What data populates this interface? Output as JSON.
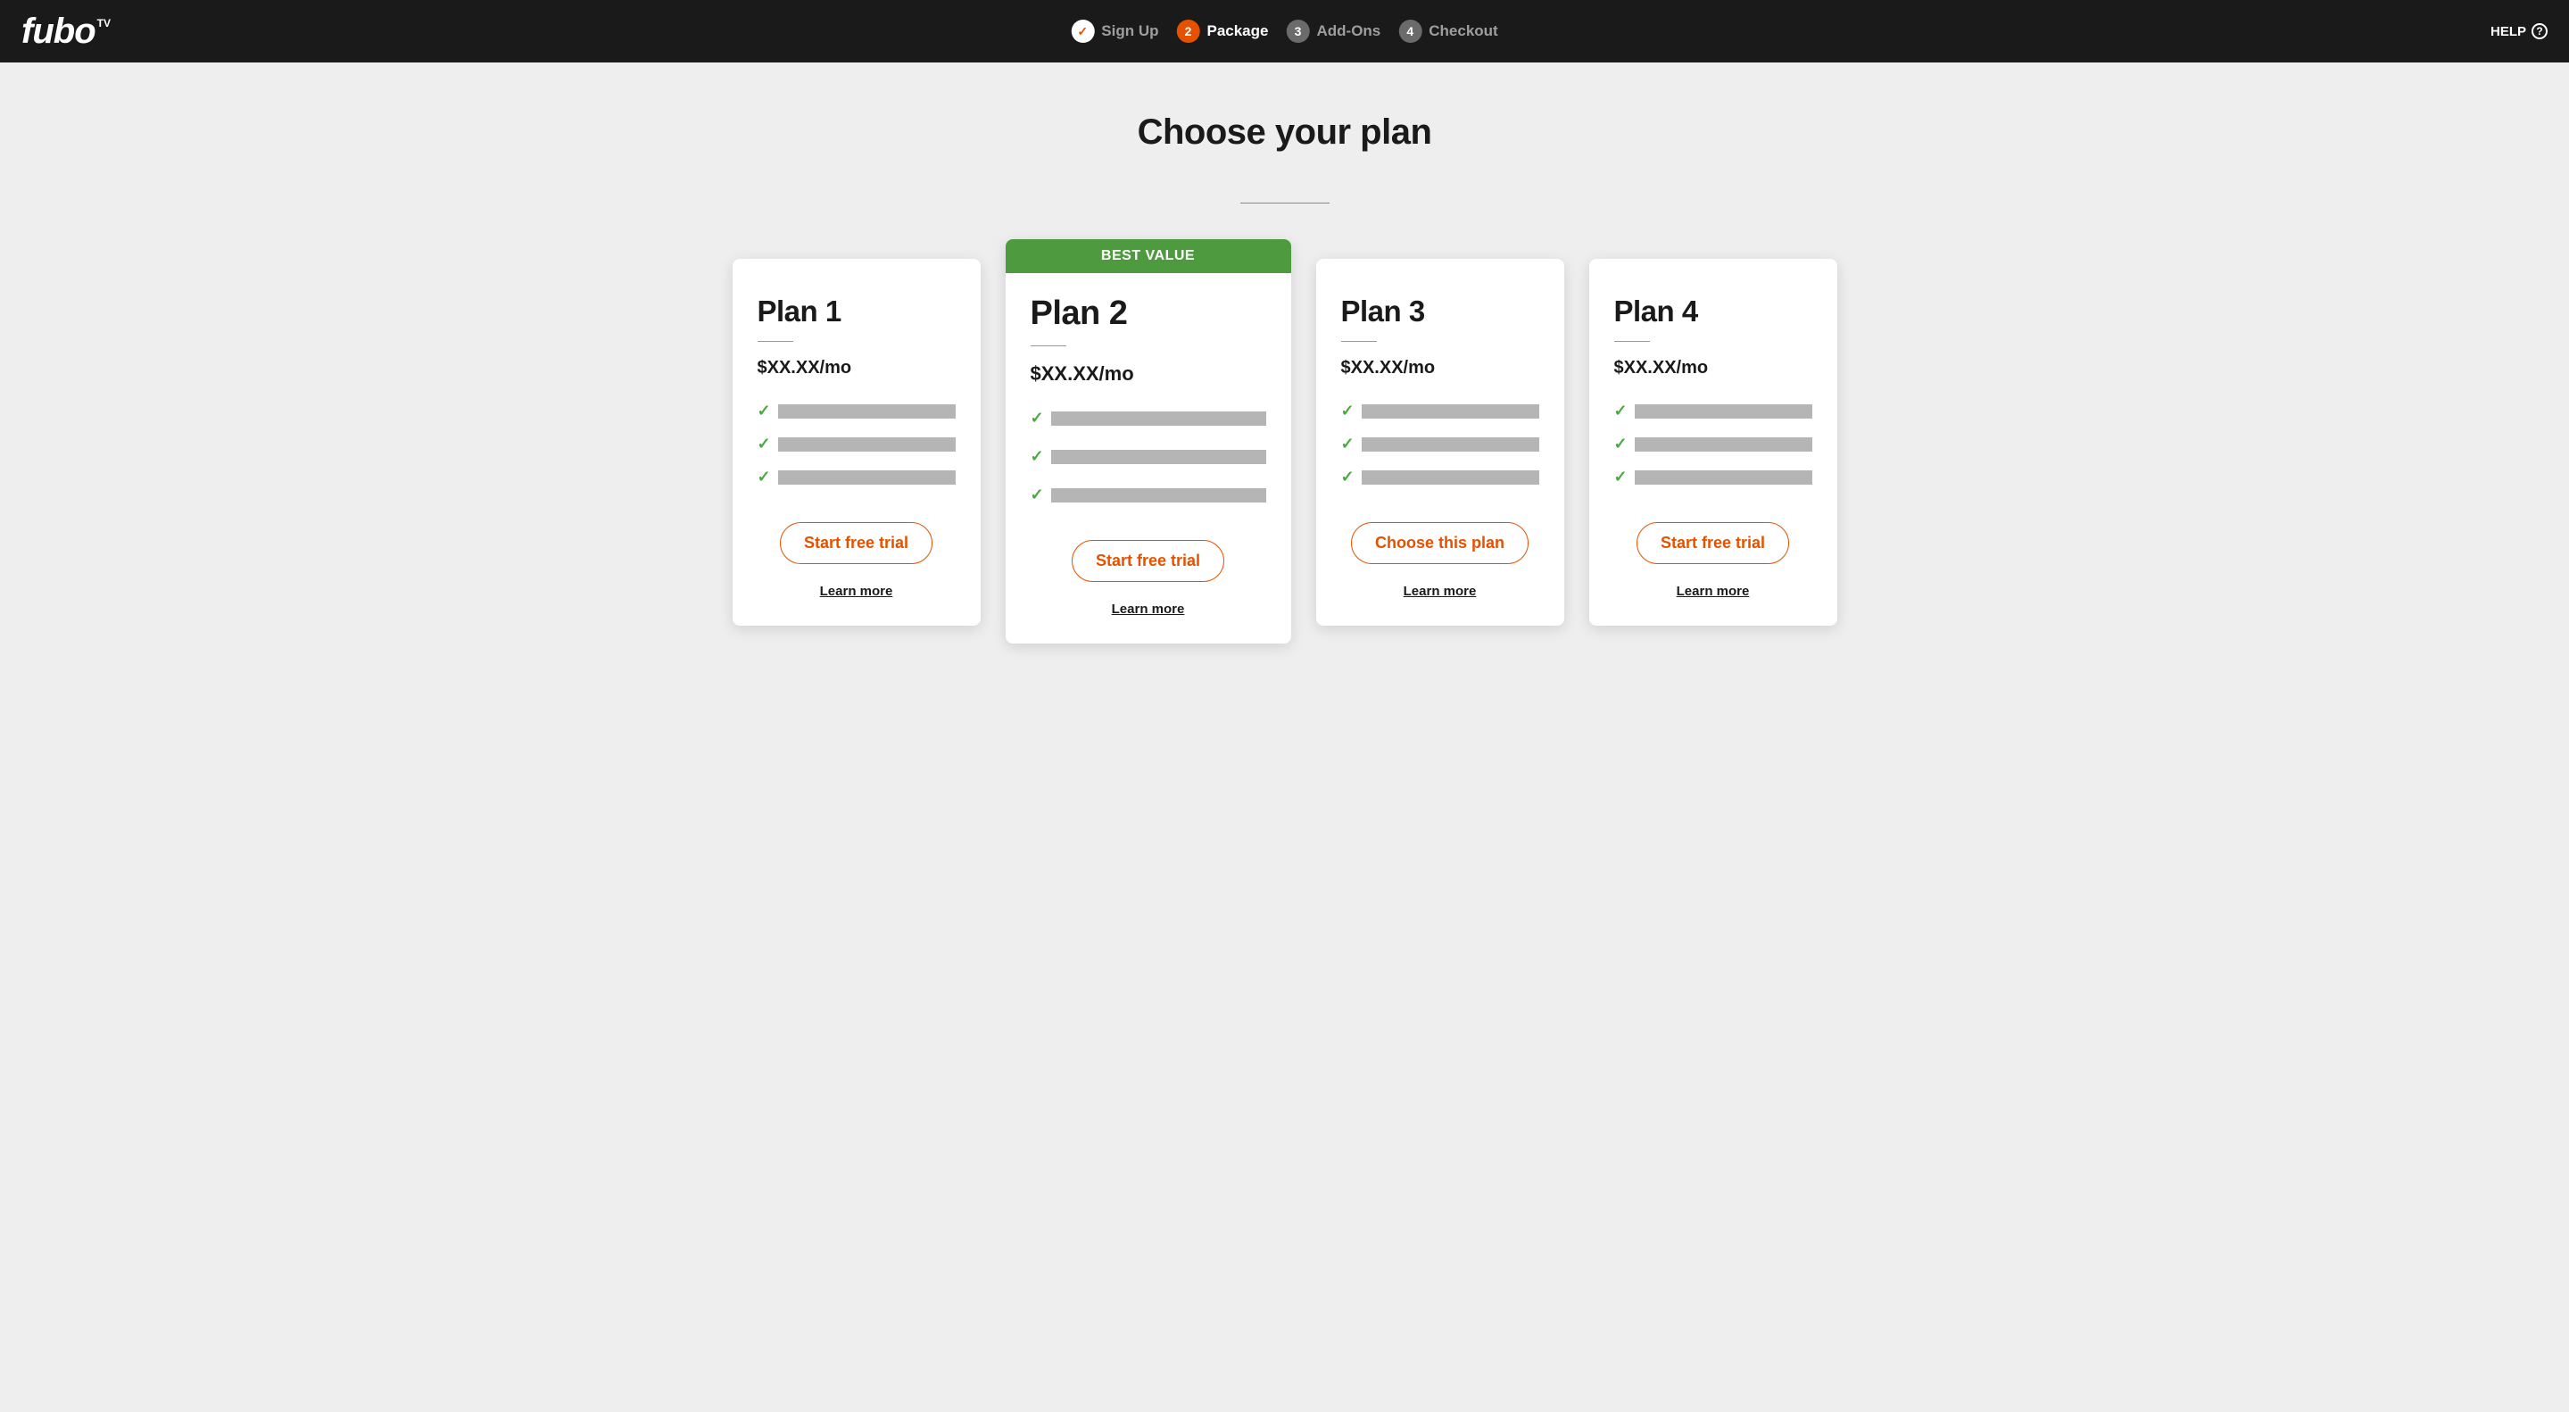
{
  "header": {
    "logo_main": "fubo",
    "logo_suffix": "TV",
    "help_label": "HELP",
    "steps": [
      {
        "num": "✓",
        "label": "Sign Up",
        "state": "done"
      },
      {
        "num": "2",
        "label": "Package",
        "state": "active"
      },
      {
        "num": "3",
        "label": "Add-Ons",
        "state": "pending"
      },
      {
        "num": "4",
        "label": "Checkout",
        "state": "pending"
      }
    ]
  },
  "title": "Choose your plan",
  "plans": [
    {
      "name": "Plan 1",
      "price": "$XX.XX/mo",
      "featured": false,
      "cta": "Start free trial",
      "learn": "Learn more"
    },
    {
      "name": "Plan 2",
      "price": "$XX.XX/mo",
      "featured": true,
      "banner": "BEST VALUE",
      "cta": "Start free trial",
      "learn": "Learn more"
    },
    {
      "name": "Plan 3",
      "price": "$XX.XX/mo",
      "featured": false,
      "cta": "Choose this plan",
      "learn": "Learn more"
    },
    {
      "name": "Plan 4",
      "price": "$XX.XX/mo",
      "featured": false,
      "cta": "Start free trial",
      "learn": "Learn more"
    }
  ]
}
